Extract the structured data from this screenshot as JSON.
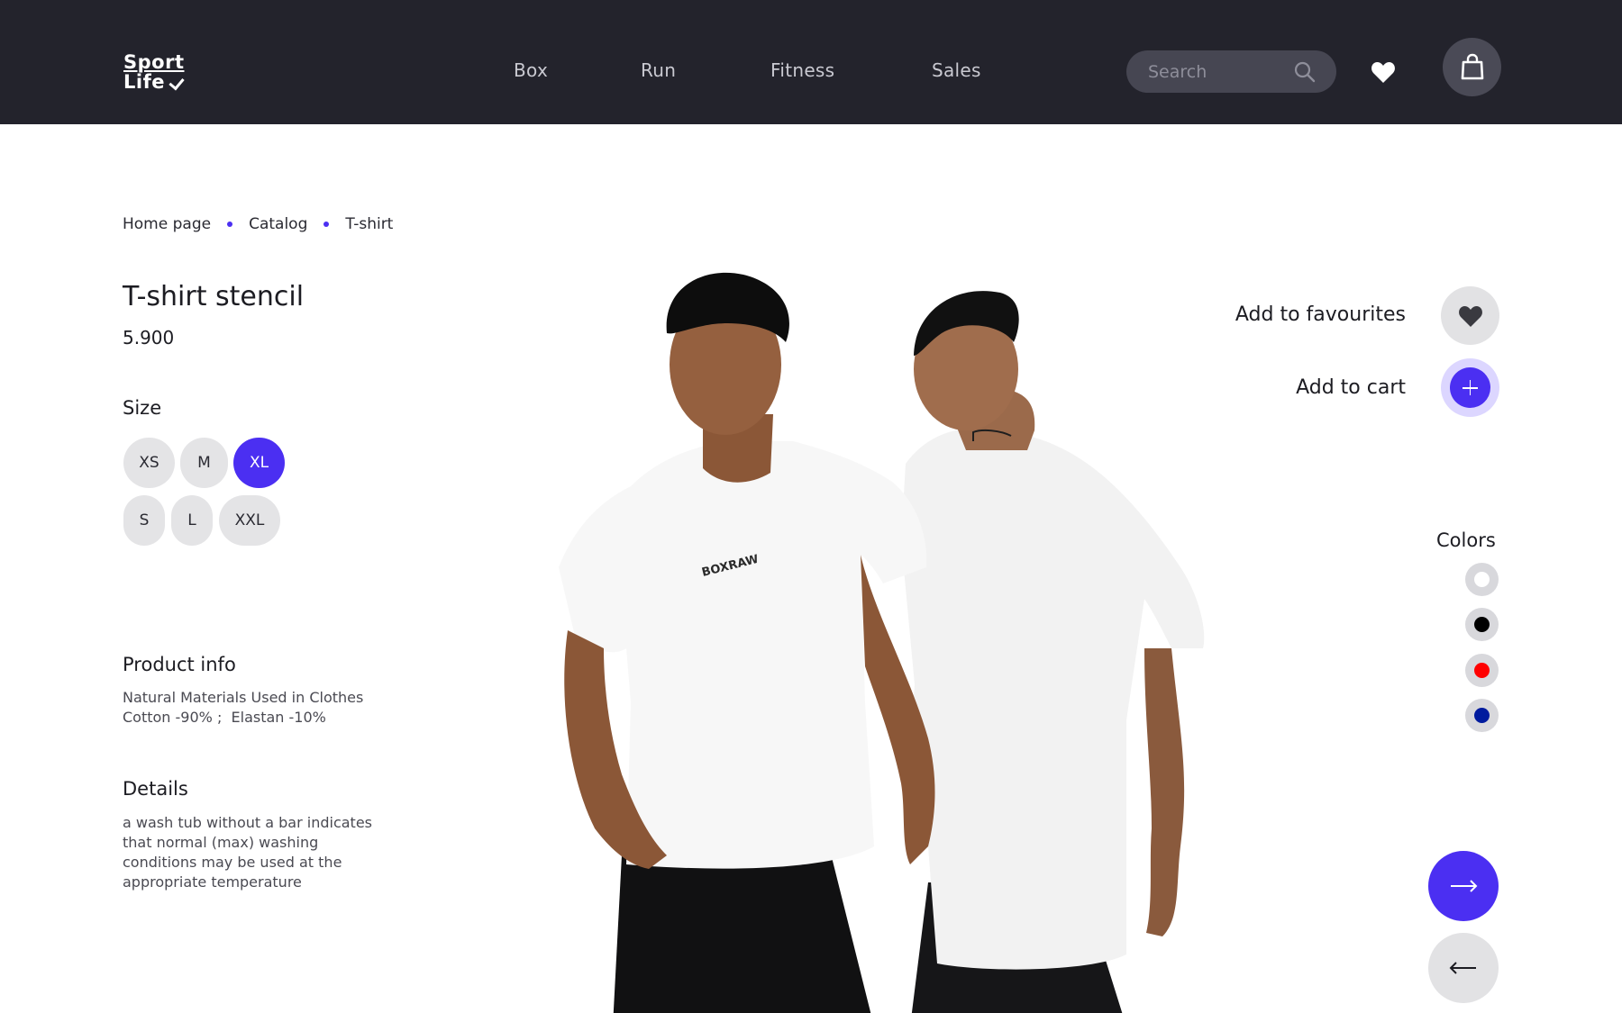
{
  "brand": {
    "line1": "Sport",
    "line2": "Life"
  },
  "nav": [
    {
      "label": "Box"
    },
    {
      "label": "Run"
    },
    {
      "label": "Fitness"
    },
    {
      "label": "Sales"
    }
  ],
  "search": {
    "placeholder": "Search",
    "value": ""
  },
  "header_icons": {
    "favourites": "heart-icon",
    "cart": "shopping-bag-icon"
  },
  "breadcrumb": [
    {
      "label": "Home page"
    },
    {
      "label": "Catalog"
    },
    {
      "label": "T-shirt"
    }
  ],
  "product": {
    "title": "T-shirt stencil",
    "price": "5.900",
    "size_label": "Size",
    "sizes": [
      {
        "label": "XS",
        "selected": false
      },
      {
        "label": "M",
        "selected": false
      },
      {
        "label": "XL",
        "selected": true
      },
      {
        "label": "S",
        "selected": false
      },
      {
        "label": "L",
        "selected": false
      },
      {
        "label": "XXL",
        "selected": false
      }
    ],
    "info_heading": "Product info",
    "info_line1": "Natural Materials Used in Clothes",
    "info_line2": "Cotton -90% ;  Elastan -10%",
    "details_heading": "Details",
    "details_text": "a wash tub without a bar indicates that normal (max) washing conditions may be used at the appropriate temperature",
    "shirt_print": "BOXRAW"
  },
  "actions": {
    "add_to_favourites": "Add to favourites",
    "add_to_cart": "Add to cart"
  },
  "colors": {
    "label": "Colors",
    "options": [
      {
        "name": "white",
        "hex": "#ffffff"
      },
      {
        "name": "black",
        "hex": "#000000"
      },
      {
        "name": "red",
        "hex": "#ff0000"
      },
      {
        "name": "blue",
        "hex": "#001b9e"
      }
    ]
  },
  "theme": {
    "accent": "#4b2ff2",
    "header_bg": "#23232c",
    "chip_bg": "#e4e4e6"
  }
}
